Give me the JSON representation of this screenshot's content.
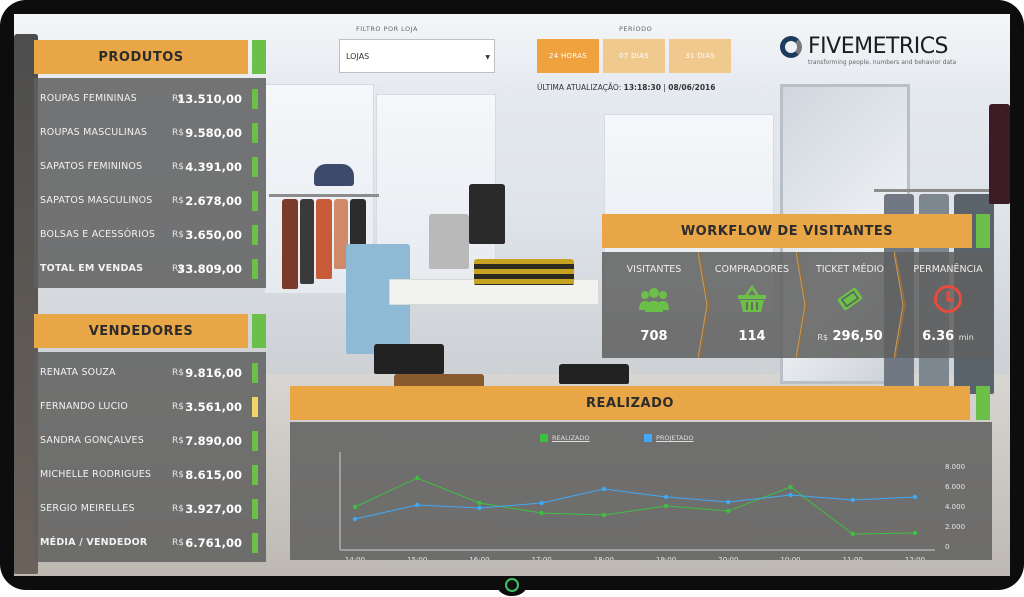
{
  "products": {
    "title": "PRODUTOS",
    "currency": "R$",
    "rows": [
      {
        "label": "ROUPAS FEMININAS",
        "value": "13.510,00",
        "color": "#6cc04a"
      },
      {
        "label": "ROUPAS MASCULINAS",
        "value": "9.580,00",
        "color": "#6cc04a"
      },
      {
        "label": "SAPATOS FEMININOS",
        "value": "4.391,00",
        "color": "#6cc04a"
      },
      {
        "label": "SAPATOS MASCULINOS",
        "value": "2.678,00",
        "color": "#6cc04a"
      },
      {
        "label": "BOLSAS E ACESSÓRIOS",
        "value": "3.650,00",
        "color": "#6cc04a"
      },
      {
        "label": "TOTAL EM VENDAS",
        "value": "33.809,00",
        "color": "#6cc04a"
      }
    ]
  },
  "sellers": {
    "title": "VENDEDORES",
    "currency": "R$",
    "rows": [
      {
        "label": "RENATA SOUZA",
        "value": "9.816,00",
        "color": "#6cc04a"
      },
      {
        "label": "FERNANDO LUCIO",
        "value": "3.561,00",
        "color": "#f2d56a"
      },
      {
        "label": "SANDRA GONÇALVES",
        "value": "7.890,00",
        "color": "#6cc04a"
      },
      {
        "label": "MICHELLE RODRIGUES",
        "value": "8.615,00",
        "color": "#6cc04a"
      },
      {
        "label": "SERGIO MEIRELLES",
        "value": "3.927,00",
        "color": "#6cc04a"
      },
      {
        "label": "MÉDIA / VENDEDOR",
        "value": "6.761,00",
        "color": "#6cc04a"
      }
    ]
  },
  "filter": {
    "label": "FILTRO POR LOJA",
    "value": "LOJAS"
  },
  "period": {
    "label": "PERÍODO",
    "options": [
      "24 HORAS",
      "07 DIAS",
      "31 DIAS"
    ],
    "active_color": "#f0a23e",
    "inactive_color": "#f0c98e"
  },
  "update": {
    "label": "ÚLTIMA ATUALIZAÇÃO:",
    "time": "13:18:30",
    "separator": "|",
    "date": "08/06/2016"
  },
  "brand": {
    "name": "FIVEMETRICS",
    "tagline": "transforming people, numbers and behavior data"
  },
  "workflow": {
    "title": "WORKFLOW DE VISITANTES",
    "items": [
      {
        "title": "VISITANTES",
        "icon": "people-icon",
        "value": "708",
        "prefix": "",
        "suffix": ""
      },
      {
        "title": "COMPRADORES",
        "icon": "basket-icon",
        "value": "114",
        "prefix": "",
        "suffix": ""
      },
      {
        "title": "TICKET MÉDIO",
        "icon": "ticket-icon",
        "value": "296,50",
        "prefix": "R$",
        "suffix": ""
      },
      {
        "title": "PERMANÊNCIA",
        "icon": "clock-icon",
        "value": "6.36",
        "prefix": "",
        "suffix": "min"
      }
    ],
    "icon_colors": {
      "people": "#6cc04a",
      "basket": "#6cc04a",
      "ticket": "#6cc04a",
      "clock": "#e84b3a"
    }
  },
  "realized": {
    "title": "REALIZADO"
  },
  "chart_data": {
    "type": "line",
    "title": "REALIZADO",
    "x": [
      "14:00",
      "15:00",
      "16:00",
      "17:00",
      "18:00",
      "19:00",
      "20:00",
      "10:00",
      "11:00",
      "12:00"
    ],
    "series": [
      {
        "name": "REALIZADO",
        "color": "#3fbf3f",
        "values": [
          3900,
          6800,
          4300,
          3300,
          3100,
          4000,
          3500,
          5900,
          1200,
          1300
        ]
      },
      {
        "name": "PROJETADO",
        "color": "#3fa9f5",
        "values": [
          2700,
          4100,
          3800,
          4300,
          5700,
          4900,
          4400,
          5100,
          4600,
          4900
        ]
      }
    ],
    "yticks": [
      "0",
      "2.000",
      "4.000",
      "6.000",
      "8.000"
    ],
    "ylim": [
      0,
      8000
    ],
    "legend": "top-center",
    "grid": false
  }
}
